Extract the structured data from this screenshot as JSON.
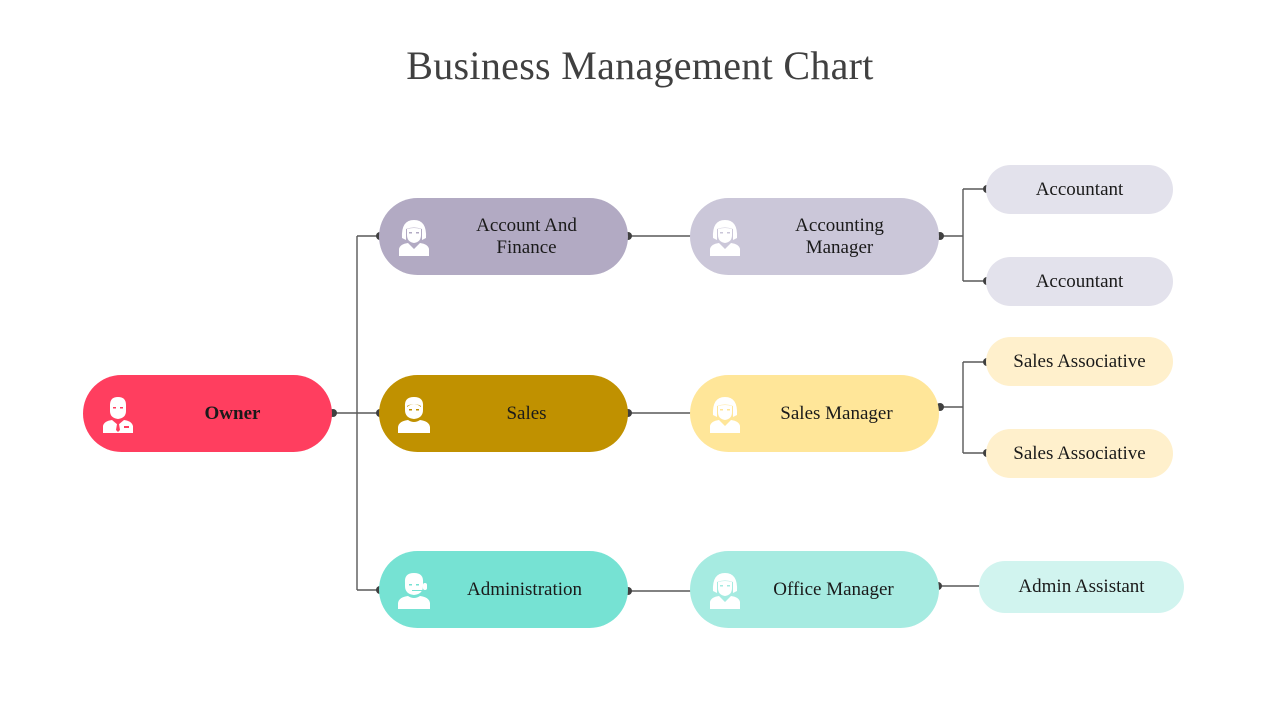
{
  "title": "Business Management Chart",
  "colors": {
    "owner": "#ff3e5f",
    "account_finance": "#b2aac3",
    "accounting_manager": "#cbc7d9",
    "accountant": "#e3e2ec",
    "sales": "#c09100",
    "sales_manager": "#ffe699",
    "sales_associative": "#fff0cc",
    "administration": "#76e2d3",
    "office_manager": "#a6ebe1",
    "admin_assistant": "#d1f4ef",
    "connector": "#595959",
    "dot": "#404040"
  },
  "nodes": {
    "owner": {
      "label": "Owner",
      "icon": "businessman-icon"
    },
    "account_finance": {
      "label": "Account And Finance",
      "icon": "woman-icon"
    },
    "accounting_manager": {
      "label": "Accounting Manager",
      "icon": "woman-icon"
    },
    "accountant_1": {
      "label": "Accountant"
    },
    "accountant_2": {
      "label": "Accountant"
    },
    "sales": {
      "label": "Sales",
      "icon": "man-icon"
    },
    "sales_manager": {
      "label": "Sales Manager",
      "icon": "woman-icon"
    },
    "sales_associative_1": {
      "label": "Sales Associative"
    },
    "sales_associative_2": {
      "label": "Sales Associative"
    },
    "administration": {
      "label": "Administration",
      "icon": "headset-operator-icon"
    },
    "office_manager": {
      "label": "Office Manager",
      "icon": "woman-icon"
    },
    "admin_assistant": {
      "label": "Admin Assistant"
    }
  }
}
